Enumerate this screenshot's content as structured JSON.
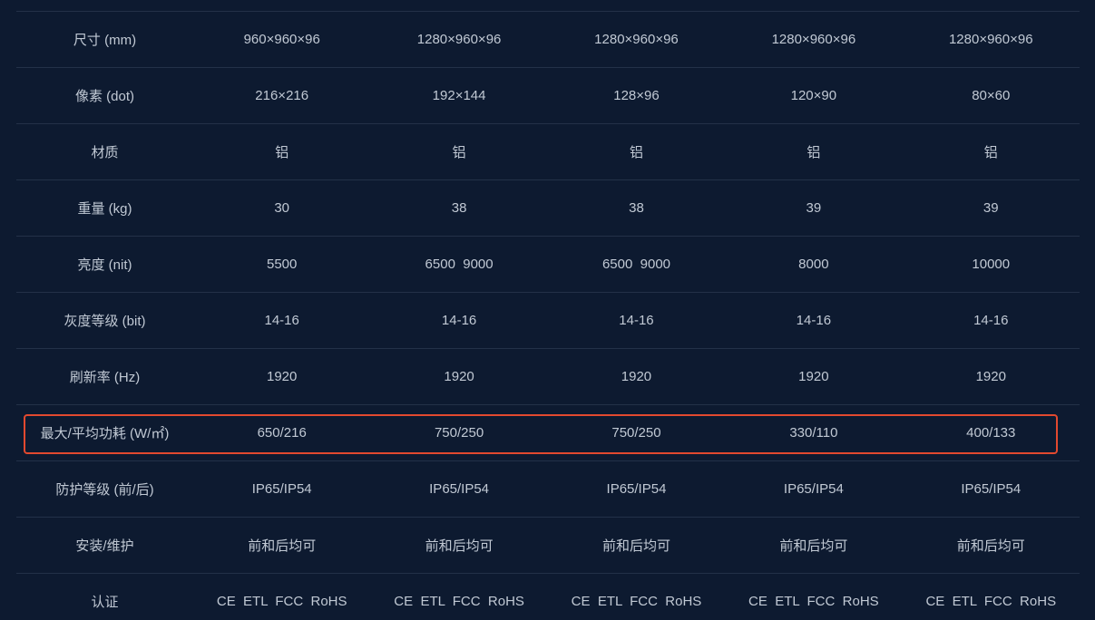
{
  "rows": [
    {
      "label": "尺寸 (mm)",
      "values": [
        "960×960×96",
        "1280×960×96",
        "1280×960×96",
        "1280×960×96",
        "1280×960×96"
      ]
    },
    {
      "label": "像素 (dot)",
      "values": [
        "216×216",
        "192×144",
        "128×96",
        "120×90",
        "80×60"
      ]
    },
    {
      "label": "材质",
      "values": [
        "铝",
        "铝",
        "铝",
        "铝",
        "铝"
      ]
    },
    {
      "label": "重量 (kg)",
      "values": [
        "30",
        "38",
        "38",
        "39",
        "39"
      ]
    },
    {
      "label": "亮度 (nit)",
      "values": [
        "5500",
        "6500  9000",
        "6500  9000",
        "8000",
        "10000"
      ]
    },
    {
      "label": "灰度等级 (bit)",
      "values": [
        "14-16",
        "14-16",
        "14-16",
        "14-16",
        "14-16"
      ]
    },
    {
      "label": "刷新率 (Hz)",
      "values": [
        "1920",
        "1920",
        "1920",
        "1920",
        "1920"
      ]
    },
    {
      "label": "最大/平均功耗 (W/㎡)",
      "values": [
        "650/216",
        "750/250",
        "750/250",
        "330/110",
        "400/133"
      ]
    },
    {
      "label": "防护等级 (前/后)",
      "values": [
        "IP65/IP54",
        "IP65/IP54",
        "IP65/IP54",
        "IP65/IP54",
        "IP65/IP54"
      ]
    },
    {
      "label": "安装/维护",
      "values": [
        "前和后均可",
        "前和后均可",
        "前和后均可",
        "前和后均可",
        "前和后均可"
      ]
    },
    {
      "label": "认证",
      "values": [
        "CE  ETL  FCC  RoHS",
        "CE  ETL  FCC  RoHS",
        "CE  ETL  FCC  RoHS",
        "CE  ETL  FCC  RoHS",
        "CE  ETL  FCC  RoHS"
      ]
    }
  ],
  "colors": {
    "background": "#0d1a30",
    "divider": "#233148",
    "text": "#c1c9d4",
    "highlight_border": "#e2492f"
  }
}
